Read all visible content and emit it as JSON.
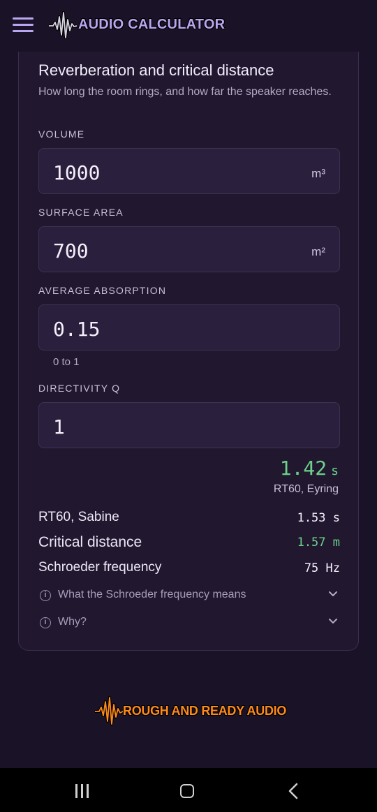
{
  "header": {
    "app_title": "AUDIO CALCULATOR",
    "menu_icon": "hamburger-menu-icon",
    "brand_color": "#b9a6f0"
  },
  "card": {
    "title": "Reverberation and critical distance",
    "subtitle": "How long the room rings, and how far the speaker reaches.",
    "fields": [
      {
        "label": "VOLUME",
        "value": "1000",
        "unit": "m³"
      },
      {
        "label": "SURFACE AREA",
        "value": "700",
        "unit": "m²"
      },
      {
        "label": "AVERAGE ABSORPTION",
        "value": "0.15",
        "unit": "",
        "hint": "0 to 1"
      },
      {
        "label": "DIRECTIVITY Q",
        "value": "1",
        "unit": ""
      }
    ],
    "primary_result": {
      "value": "1.42",
      "unit": "s",
      "caption": "RT60, Eyring"
    },
    "results": [
      {
        "label": "RT60, Sabine",
        "value": "1.53 s"
      },
      {
        "label": "Critical distance",
        "value": "1.57 m"
      },
      {
        "label": "Schroeder frequency",
        "value": "75 Hz"
      }
    ],
    "expanders": [
      {
        "label": "What the Schroeder frequency means"
      },
      {
        "label": "Why?"
      }
    ],
    "accent_green": "#6ed18a"
  },
  "footer": {
    "brand_text": "ROUGH AND READY AUDIO",
    "brand_color": "#ff8a1a"
  },
  "system_nav": {
    "icons": [
      "recent-apps-icon",
      "home-icon",
      "back-icon"
    ]
  }
}
